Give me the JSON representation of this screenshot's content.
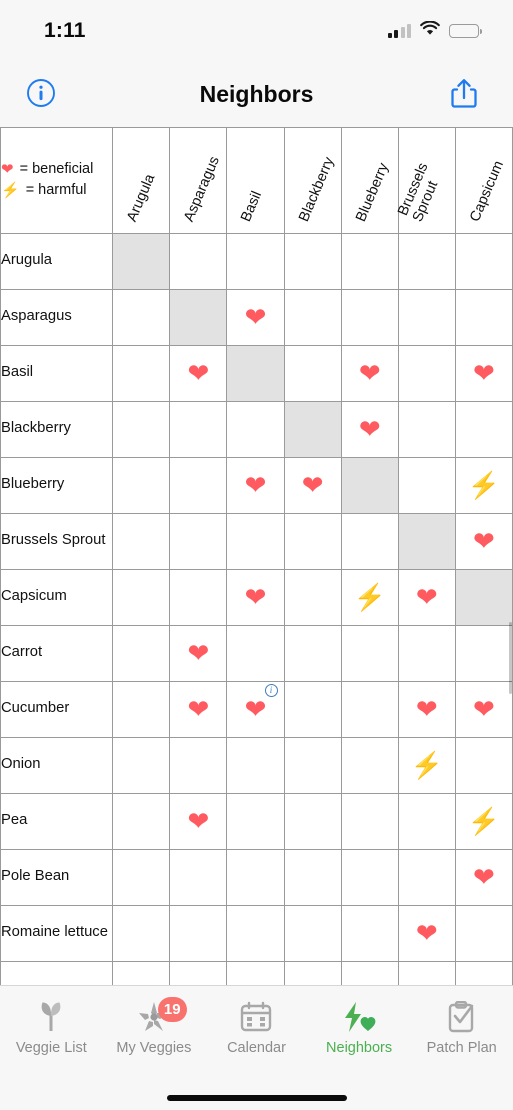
{
  "statusbar": {
    "time": "1:11",
    "signal_icon": "cellular-signal-icon",
    "wifi_icon": "wifi-icon",
    "battery_icon": "battery-low-icon",
    "battery_level_percent": 22
  },
  "navbar": {
    "title": "Neighbors",
    "info_button_label": "i",
    "share_button_label": "Share"
  },
  "legend": {
    "beneficial_symbol": "❤️",
    "beneficial_text": "= beneficial",
    "harmful_symbol": "⚡",
    "harmful_text": "= harmful",
    "heart_color": "#ff5a5f",
    "bolt_color": "#f7c325"
  },
  "table": {
    "columns": [
      "Arugula",
      "Asparagus",
      "Basil",
      "Blackberry",
      "Blueberry",
      "Brussels\nSprout",
      "Capsicum"
    ],
    "rows": [
      {
        "label": "Arugula",
        "cells": [
          "diag",
          "",
          "",
          "",
          "",
          "",
          ""
        ]
      },
      {
        "label": "Asparagus",
        "cells": [
          "",
          "diag",
          "heart",
          "",
          "",
          "",
          ""
        ]
      },
      {
        "label": "Basil",
        "cells": [
          "",
          "heart",
          "diag",
          "",
          "heart",
          "",
          "heart"
        ]
      },
      {
        "label": "Blackberry",
        "cells": [
          "",
          "",
          "",
          "diag",
          "heart",
          "",
          ""
        ]
      },
      {
        "label": "Blueberry",
        "cells": [
          "",
          "",
          "heart",
          "heart",
          "diag",
          "",
          "bolt"
        ]
      },
      {
        "label": "Brussels Sprout",
        "cells": [
          "",
          "",
          "",
          "",
          "",
          "diag",
          "heart"
        ]
      },
      {
        "label": "Capsicum",
        "cells": [
          "",
          "",
          "heart",
          "",
          "bolt",
          "heart",
          "diag"
        ]
      },
      {
        "label": "Carrot",
        "cells": [
          "",
          "heart",
          "",
          "",
          "",
          "",
          ""
        ]
      },
      {
        "label": "Cucumber",
        "cells": [
          "",
          "heart",
          "heart-info",
          "",
          "",
          "heart",
          "heart"
        ]
      },
      {
        "label": "Onion",
        "cells": [
          "",
          "",
          "",
          "",
          "",
          "bolt",
          ""
        ]
      },
      {
        "label": "Pea",
        "cells": [
          "",
          "heart",
          "",
          "",
          "",
          "",
          "bolt"
        ]
      },
      {
        "label": "Pole Bean",
        "cells": [
          "",
          "",
          "",
          "",
          "",
          "",
          "heart"
        ]
      },
      {
        "label": "Romaine lettuce",
        "cells": [
          "",
          "",
          "",
          "",
          "",
          "heart",
          ""
        ]
      },
      {
        "label": "",
        "cells": [
          "",
          "",
          "",
          "",
          "",
          "",
          ""
        ]
      }
    ],
    "info_badge_label": "i",
    "diagonal_cell_color": "#e2e2e2",
    "gridline_color": "#9a9a9a"
  },
  "tabbar": {
    "active_color": "#4caf50",
    "inactive_color": "#8b8b8b",
    "items": [
      {
        "label": "Veggie List",
        "icon": "leaf-icon",
        "active": false,
        "badge": null
      },
      {
        "label": "My Veggies",
        "icon": "flower-star-icon",
        "active": false,
        "badge": "19"
      },
      {
        "label": "Calendar",
        "icon": "calendar-icon",
        "active": false,
        "badge": null
      },
      {
        "label": "Neighbors",
        "icon": "bolt-heart-icon",
        "active": true,
        "badge": null
      },
      {
        "label": "Patch Plan",
        "icon": "clipboard-check-icon",
        "active": false,
        "badge": null
      }
    ]
  }
}
